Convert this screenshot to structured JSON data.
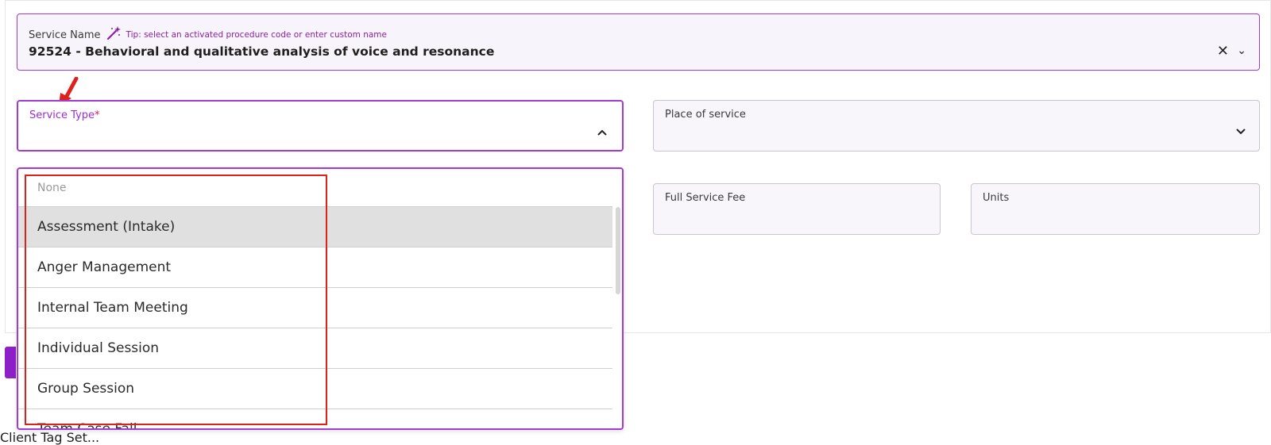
{
  "service_name": {
    "label": "Service Name",
    "tip": "Tip: select an activated procedure code or enter custom name",
    "value": "92524 - Behavioral and qualitative analysis of voice and resonance",
    "clear_icon": "close-icon",
    "toggle_icon": "chevron-down-icon"
  },
  "service_type": {
    "label": "Service Type",
    "required_mark": "*",
    "toggle_icon": "chevron-up-icon",
    "options": [
      "None",
      "Assessment (Intake)",
      "Anger Management",
      "Internal Team Meeting",
      "Individual Session",
      "Group Session",
      "Team Case Fall..."
    ],
    "highlighted_option": "Assessment (Intake)"
  },
  "place_of_service": {
    "label": "Place of service",
    "toggle_icon": "chevron-down-icon"
  },
  "full_service_fee": {
    "label": "Full Service Fee"
  },
  "units": {
    "label": "Units"
  },
  "footer_text": "Client Tag Set...",
  "colors": {
    "accent": "#a13bd6",
    "highlight_box": "#e0201b",
    "annotation_arrow": "#e0201b",
    "button": "#8d1fc9"
  }
}
